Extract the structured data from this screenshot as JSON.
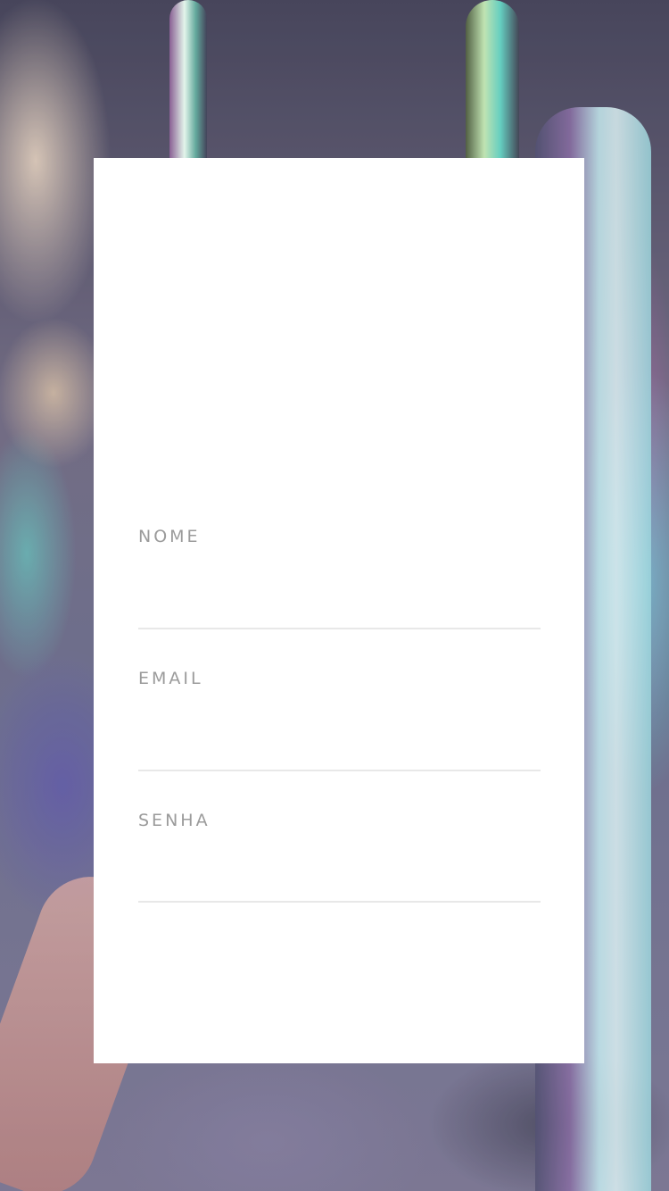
{
  "background": {
    "description_icon": "party-bottles-photo-icon",
    "tint": "#5f5873"
  },
  "form": {
    "fields": [
      {
        "label": "NOME",
        "value": "",
        "placeholder": ""
      },
      {
        "label": "EMAIL",
        "value": "",
        "placeholder": ""
      },
      {
        "label": "SENHA",
        "value": "",
        "placeholder": ""
      }
    ]
  },
  "colors": {
    "label": "#9b9b9b",
    "divider": "#e8e8e8",
    "card": "#ffffff"
  }
}
